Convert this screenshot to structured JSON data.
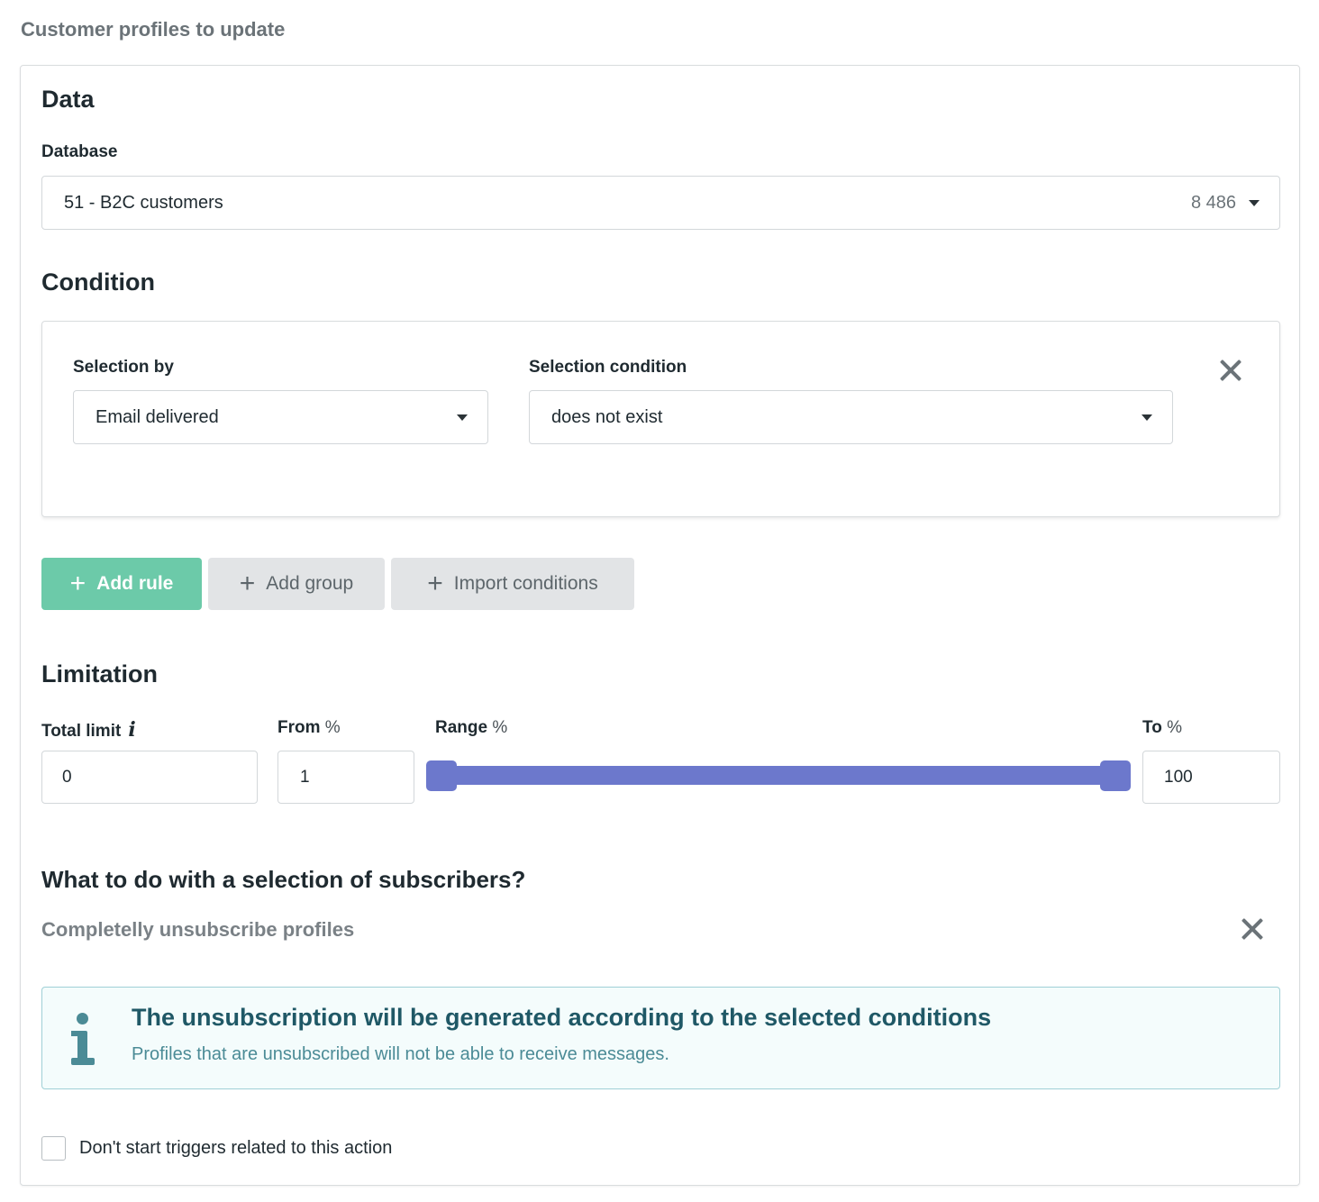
{
  "page": {
    "heading": "Customer profiles to update"
  },
  "data_section": {
    "title": "Data",
    "database_label": "Database",
    "database_value": "51 - B2C customers",
    "database_count": "8 486"
  },
  "condition_section": {
    "title": "Condition",
    "selection_by_label": "Selection by",
    "selection_by_value": "Email delivered",
    "selection_condition_label": "Selection condition",
    "selection_condition_value": "does not exist"
  },
  "buttons": {
    "add_rule": "Add rule",
    "add_group": "Add group",
    "import_conditions": "Import conditions",
    "plus_glyph": "+"
  },
  "limitation": {
    "title": "Limitation",
    "total_limit_label": "Total limit",
    "total_limit_value": "0",
    "from_label": "From",
    "from_value": "1",
    "range_label": "Range",
    "to_label": "To",
    "to_value": "100",
    "unit": "%",
    "info_glyph": "i",
    "range": {
      "from_percent": 1,
      "to_percent": 100
    }
  },
  "subscribers": {
    "question": "What to do with a selection of subscribers?",
    "action": "Completelly unsubscribe profiles"
  },
  "alert": {
    "title": "The unsubscription will be generated according to the selected conditions",
    "body": "Profiles that are unsubscribed will not be able to receive messages."
  },
  "options": {
    "dont_start_triggers_label": "Don't start triggers related to this action",
    "dont_start_triggers_checked": false
  },
  "colors": {
    "accent_green": "#6ccaa9",
    "slider_blue": "#6c78cc",
    "info_teal": "#4b8b96"
  }
}
